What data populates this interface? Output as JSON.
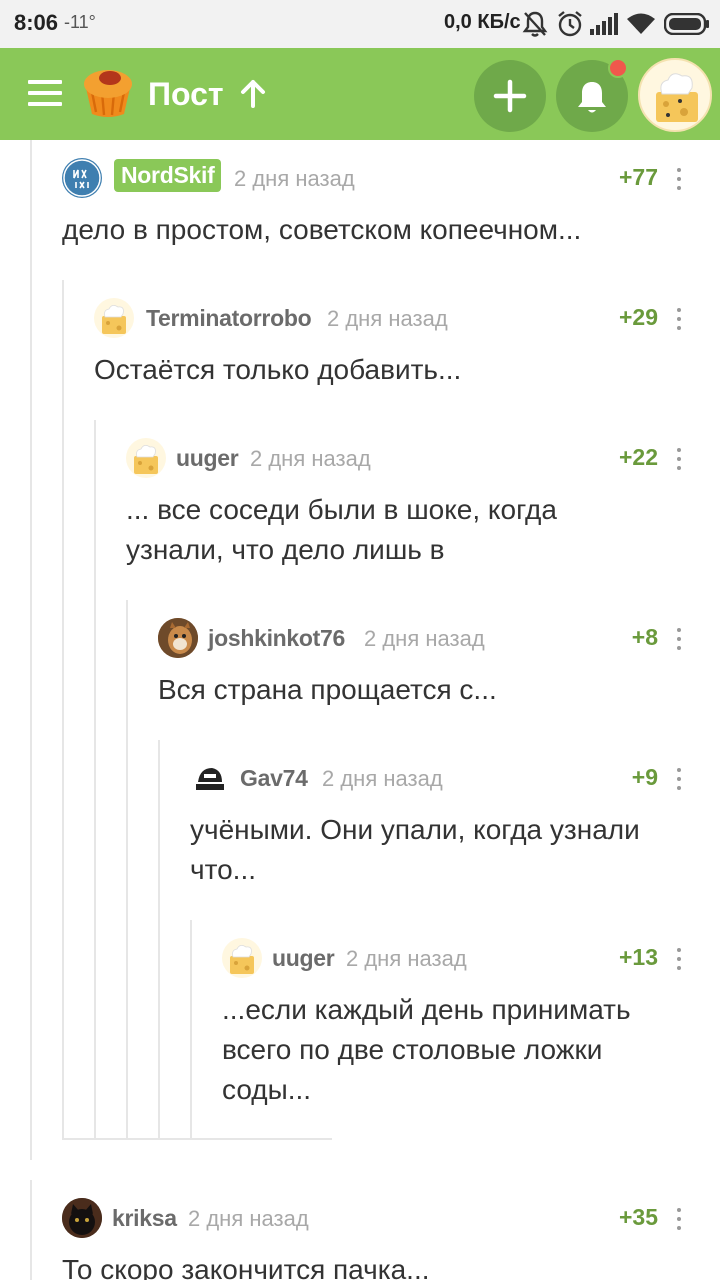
{
  "status_bar": {
    "time": "8:06",
    "temperature": "-11°",
    "net_speed": "0,0 КБ/с",
    "icons": [
      "mute-alarm-icon",
      "alarm-clock-icon",
      "signal-icon",
      "wifi-icon",
      "battery-icon"
    ]
  },
  "header": {
    "title": "Пост",
    "icons": [
      "menu-icon",
      "pikabu-logo",
      "arrow-up-icon",
      "plus-icon",
      "bell-icon"
    ],
    "notification_dot_color": "#f0584c",
    "bar_color": "#8ac858"
  },
  "comments": [
    {
      "author": "NordSkif",
      "time": "2 дня назад",
      "rating": "+77",
      "text": "дело в простом, советском копеечном..."
    },
    {
      "author": "Terminatorrobo",
      "time": "2 дня назад",
      "rating": "+29",
      "text": "Остаётся только добавить..."
    },
    {
      "author": "uuger",
      "time": "2 дня назад",
      "rating": "+22",
      "text": "... все соседи были в шоке, когда узнали, что дело лишь в"
    },
    {
      "author": "joshkinkot76",
      "time": "2 дня назад",
      "rating": "+8",
      "text": "Вся страна прощается с..."
    },
    {
      "author": "Gav74",
      "time": "2 дня назад",
      "rating": "+9",
      "text": "учёными. Они упали, когда узнали что..."
    },
    {
      "author": "uuger",
      "time": "2 дня назад",
      "rating": "+13",
      "text": "...если каждый день принимать всего по две столовые ложки соды..."
    },
    {
      "author": "kriksa",
      "time": "2 дня назад",
      "rating": "+35",
      "text": "То скоро закончится пачка..."
    }
  ],
  "colors": {
    "accent": "#8ac858",
    "rating": "#6a9a3c",
    "muted": "#a8a8a8"
  }
}
